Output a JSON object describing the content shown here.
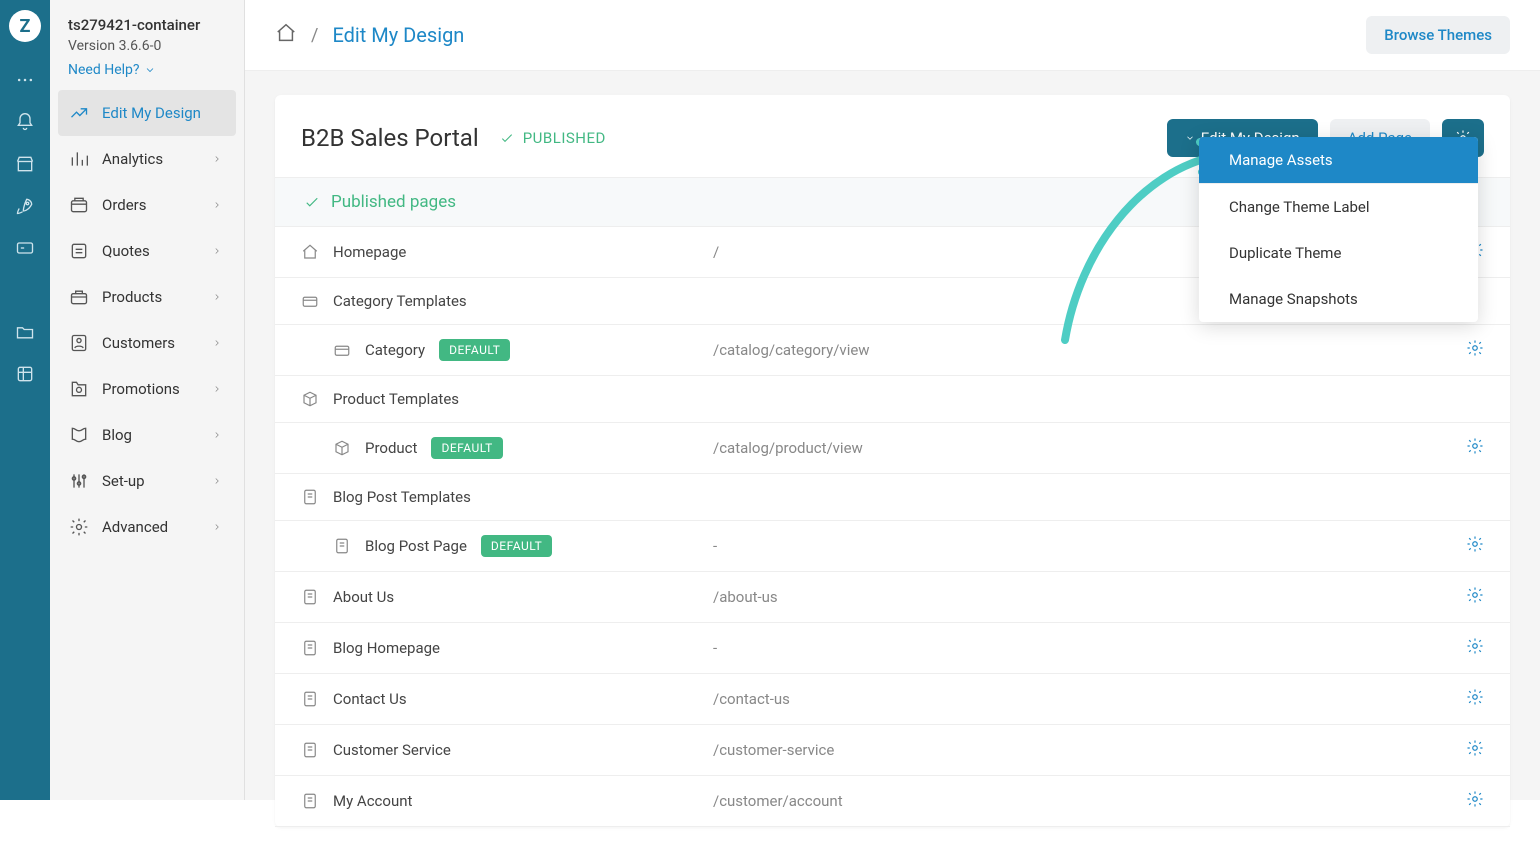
{
  "sidebar": {
    "container": "ts279421-container",
    "version": "Version 3.6.6-0",
    "help": "Need Help?",
    "nav": [
      {
        "label": "Edit My Design",
        "active": true,
        "chev": false
      },
      {
        "label": "Analytics",
        "active": false,
        "chev": true
      },
      {
        "label": "Orders",
        "active": false,
        "chev": true
      },
      {
        "label": "Quotes",
        "active": false,
        "chev": true
      },
      {
        "label": "Products",
        "active": false,
        "chev": true
      },
      {
        "label": "Customers",
        "active": false,
        "chev": true
      },
      {
        "label": "Promotions",
        "active": false,
        "chev": true
      },
      {
        "label": "Blog",
        "active": false,
        "chev": true
      },
      {
        "label": "Set-up",
        "active": false,
        "chev": true
      },
      {
        "label": "Advanced",
        "active": false,
        "chev": true
      }
    ]
  },
  "breadcrumb": {
    "current": "Edit My Design"
  },
  "topbar": {
    "browse": "Browse Themes"
  },
  "panel": {
    "title": "B2B Sales Portal",
    "status": "PUBLISHED",
    "editBtn": "Edit My Design",
    "addBtn": "Add Page",
    "section": "Published pages",
    "defaultBadge": "DEFAULT",
    "rows": [
      {
        "type": "page",
        "label": "Homepage",
        "path": "/",
        "icon": "home"
      },
      {
        "type": "group",
        "label": "Category Templates",
        "icon": "tag"
      },
      {
        "type": "sub",
        "label": "Category",
        "path": "/catalog/category/view",
        "icon": "tag",
        "default": true
      },
      {
        "type": "group",
        "label": "Product Templates",
        "icon": "box"
      },
      {
        "type": "sub",
        "label": "Product",
        "path": "/catalog/product/view",
        "icon": "box",
        "default": true
      },
      {
        "type": "group",
        "label": "Blog Post Templates",
        "icon": "doc"
      },
      {
        "type": "sub",
        "label": "Blog Post Page",
        "path": "-",
        "icon": "doc",
        "default": true
      },
      {
        "type": "page",
        "label": "About Us",
        "path": "/about-us",
        "icon": "doc"
      },
      {
        "type": "page",
        "label": "Blog Homepage",
        "path": "-",
        "icon": "doc"
      },
      {
        "type": "page",
        "label": "Contact Us",
        "path": "/contact-us",
        "icon": "doc"
      },
      {
        "type": "page",
        "label": "Customer Service",
        "path": "/customer-service",
        "icon": "doc"
      },
      {
        "type": "page",
        "label": "My Account",
        "path": "/customer/account",
        "icon": "doc"
      }
    ]
  },
  "dropdown": {
    "items": [
      {
        "label": "Manage Assets",
        "active": true
      },
      {
        "label": "Change Theme Label"
      },
      {
        "label": "Duplicate Theme"
      },
      {
        "label": "Manage Snapshots"
      }
    ]
  }
}
